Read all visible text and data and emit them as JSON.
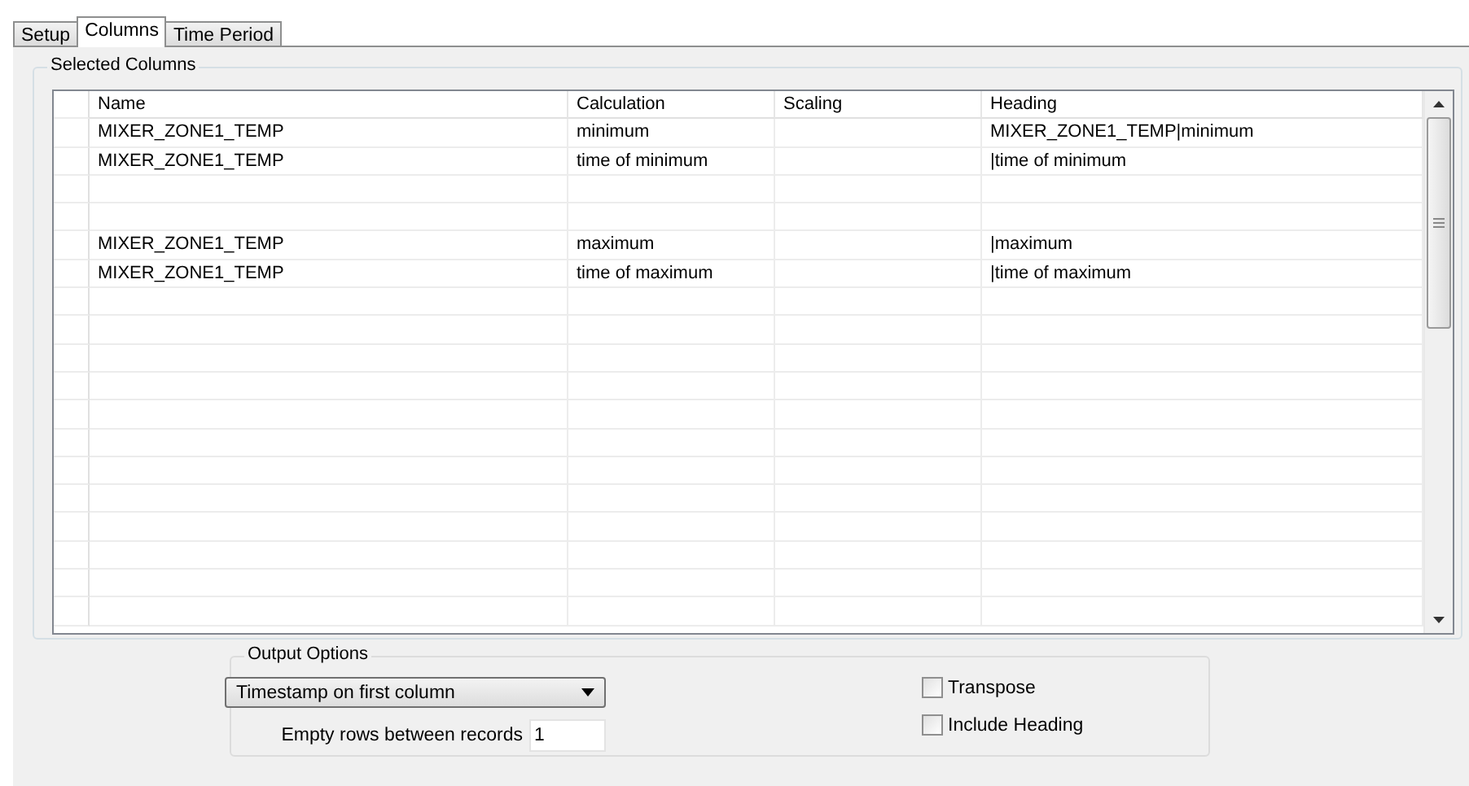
{
  "tabs": [
    {
      "label": "Setup",
      "selected": false
    },
    {
      "label": "Columns",
      "selected": true
    },
    {
      "label": "Time Period",
      "selected": false
    }
  ],
  "selected_columns": {
    "title": "Selected Columns",
    "columns": [
      "Name",
      "Calculation",
      "Scaling",
      "Heading"
    ],
    "rows": [
      {
        "name": "MIXER_ZONE1_TEMP",
        "calculation": "minimum",
        "heading": "MIXER_ZONE1_TEMP|minimum"
      },
      {
        "name": "MIXER_ZONE1_TEMP",
        "calculation": "time of minimum",
        "heading": "|time of minimum"
      },
      {},
      {},
      {
        "name": "MIXER_ZONE1_TEMP",
        "calculation": "maximum",
        "heading": "|maximum"
      },
      {
        "name": "MIXER_ZONE1_TEMP",
        "calculation": "time of maximum",
        "heading": "|time of maximum"
      }
    ]
  },
  "output_options": {
    "title": "Output Options",
    "timestamp_dropdown": "Timestamp on first column",
    "empty_rows_label": "Empty rows between records",
    "empty_rows_value": "1",
    "checkboxes": [
      {
        "label": "Transpose",
        "checked": false
      },
      {
        "label": "Include Heading",
        "checked": false
      }
    ]
  }
}
